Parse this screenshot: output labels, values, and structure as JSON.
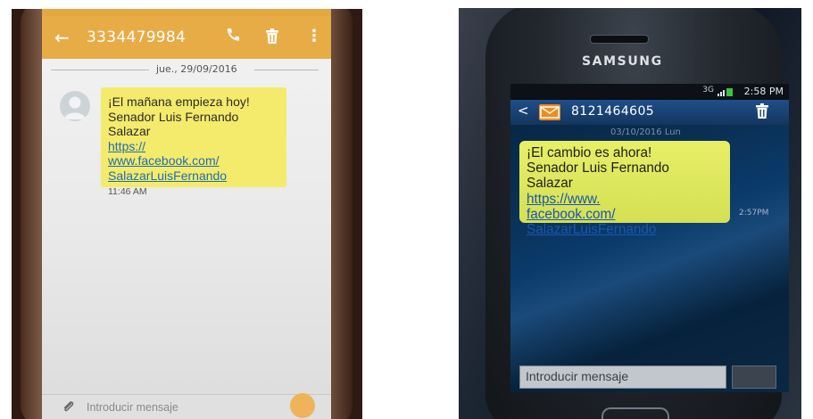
{
  "left_phone": {
    "contact": "3334479984",
    "date": "jue., 29/09/2016",
    "message_text": "¡El mañana empieza hoy!\nSenador Luis Fernando\nSalazar",
    "link_lines": [
      "https://",
      "www.facebook.com/",
      "SalazarLuisFernando"
    ],
    "time": "11:46 AM",
    "input_placeholder": "Introducir mensaje",
    "accent_color": "#e8ac47",
    "bubble_color": "#f4ea6b",
    "icons": [
      "back-arrow-icon",
      "phone-icon",
      "trash-icon",
      "more-options-icon",
      "contact-avatar-icon",
      "attachment-icon",
      "send-icon"
    ]
  },
  "right_phone": {
    "brand": "SAMSUNG",
    "status_time": "2:58 PM",
    "network": "3G",
    "contact": "8121464605",
    "date": "03/10/2016 Lun",
    "message_text": "¡El cambio es ahora!\nSenador Luis Fernando\nSalazar",
    "link_lines": [
      "https://www.",
      "facebook.com/",
      "SalazarLuisFernando"
    ],
    "time": "2:57PM",
    "input_placeholder": "Introducir mensaje",
    "accent_color": "#1f4e8a",
    "bubble_color": "#e1ea60",
    "icons": [
      "back-arrow-icon",
      "message-icon",
      "trash-icon",
      "alarm-icon",
      "signal-icon",
      "battery-icon",
      "send-icon"
    ]
  }
}
